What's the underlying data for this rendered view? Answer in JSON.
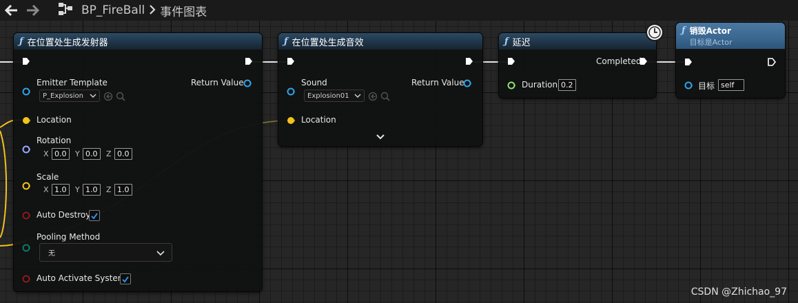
{
  "breadcrumb": {
    "blueprint": "BP_FireBall",
    "graph": "事件图表"
  },
  "node_spawn_emitter": {
    "title": "在位置处生成发射器",
    "emitter_template_label": "Emitter Template",
    "emitter_template_value": "P_Explosion",
    "return_value_label": "Return Value",
    "location_label": "Location",
    "rotation_label": "Rotation",
    "rotation": {
      "x": "0.0",
      "y": "0.0",
      "z": "0.0"
    },
    "scale_label": "Scale",
    "scale": {
      "x": "1.0",
      "y": "1.0",
      "z": "1.0"
    },
    "auto_destroy_label": "Auto Destroy",
    "pooling_method_label": "Pooling Method",
    "pooling_method_value": "无",
    "auto_activate_label": "Auto Activate System"
  },
  "node_spawn_sound": {
    "title": "在位置处生成音效",
    "sound_label": "Sound",
    "sound_value": "Explosion01",
    "return_value_label": "Return Value",
    "location_label": "Location"
  },
  "node_delay": {
    "title": "延迟",
    "completed_label": "Completed",
    "duration_label": "Duration",
    "duration_value": "0.2"
  },
  "node_destroy": {
    "title": "销毁Actor",
    "subtitle": "目标是Actor",
    "target_label": "目标",
    "target_value": "self"
  },
  "axis_labels": {
    "x": "X",
    "y": "Y",
    "z": "Z"
  },
  "watermark": "CSDN @Zhichao_97",
  "colors": {
    "exec": "#ffffff",
    "object_pin": "#2fa4e8",
    "vector_pin": "#f2c41a",
    "rotator_pin": "#9aa8ff",
    "bool_pin": "#8b1a1a",
    "byte_pin": "#0a7a6a",
    "float_pin": "#8ee06b",
    "header": "#1e3346",
    "checkbox_blue": "#2f8fe8"
  },
  "icons": [
    "back-arrow-icon",
    "forward-arrow-icon",
    "blueprint-graph-icon",
    "breadcrumb-chevron-icon",
    "function-icon",
    "exec-pin-icon",
    "chevron-down-icon",
    "browse-icon",
    "search-icon",
    "clock-icon",
    "check-icon",
    "expand-chevron-icon"
  ]
}
